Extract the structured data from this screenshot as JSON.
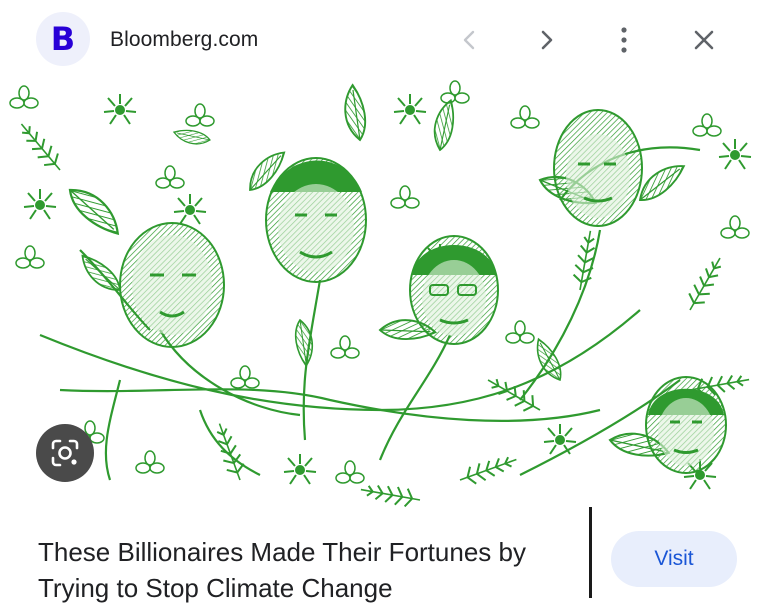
{
  "source": {
    "favicon_letter": "B",
    "site_name": "Bloomberg.com"
  },
  "nav": {
    "prev_icon": "chevron-left-icon",
    "next_icon": "chevron-right-icon",
    "more_icon": "more-vertical-icon",
    "close_icon": "close-icon"
  },
  "image": {
    "alt": "Illustration: green engraved botanical drawing with faces of billionaires among leaves and flowers"
  },
  "lens_icon": "google-lens-icon",
  "caption": {
    "line1": "These Billionaires Made Their Fortunes by",
    "line2": "Trying to Stop Climate Change"
  },
  "visit_label": "Visit",
  "colors": {
    "brand": "#2800d7",
    "illustration_green": "#2f9a2f",
    "visit_bg": "#e8eefc",
    "visit_text": "#1a56d6"
  }
}
